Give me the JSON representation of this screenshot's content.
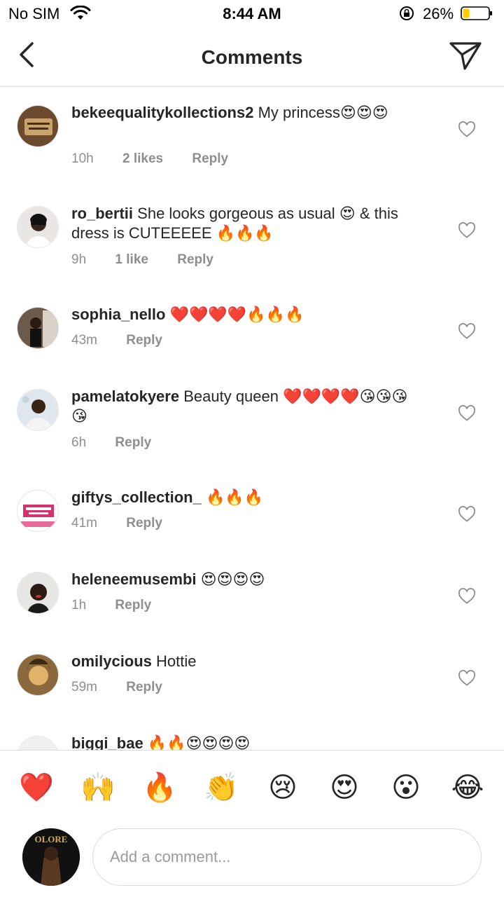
{
  "status_bar": {
    "carrier": "No SIM",
    "time": "8:44 AM",
    "battery_percent": "26%",
    "battery_level": 0.26,
    "battery_color": "#ffcc00"
  },
  "header": {
    "title": "Comments"
  },
  "comments": [
    {
      "username": "bekeequalitykollections2",
      "text": "My princess😍😍😍",
      "time": "10h",
      "likes": "2 likes",
      "reply": "Reply"
    },
    {
      "username": "ro_bertii",
      "text": "She looks gorgeous as usual 😍 & this dress is CUTEEEEE 🔥🔥🔥",
      "time": "9h",
      "likes": "1 like",
      "reply": "Reply"
    },
    {
      "username": "sophia_nello",
      "text": "❤️❤️❤️❤️🔥🔥🔥",
      "time": "43m",
      "likes": "",
      "reply": "Reply"
    },
    {
      "username": "pamelatokyere",
      "text": "Beauty queen ❤️❤️❤️❤️😘😘😘😘",
      "time": "6h",
      "likes": "",
      "reply": "Reply"
    },
    {
      "username": "giftys_collection_",
      "text": "🔥🔥🔥",
      "time": "41m",
      "likes": "",
      "reply": "Reply"
    },
    {
      "username": "heleneemusembi",
      "text": "😍😍😍😍",
      "time": "1h",
      "likes": "",
      "reply": "Reply"
    },
    {
      "username": "omilycious",
      "text": "Hottie",
      "time": "59m",
      "likes": "",
      "reply": "Reply"
    },
    {
      "username": "biggi_bae",
      "text": "🔥🔥😍😍😍😍",
      "time": "",
      "likes": "",
      "reply": ""
    }
  ],
  "emoji_bar": [
    "❤️",
    "🙌",
    "🔥",
    "👏",
    "😢",
    "😍",
    "😮",
    "😂"
  ],
  "composer": {
    "placeholder": "Add a comment...",
    "avatar_text": "OLORE"
  }
}
